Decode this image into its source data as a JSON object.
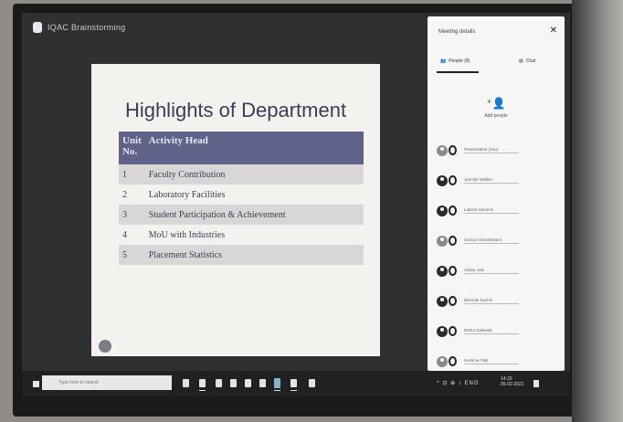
{
  "app": {
    "title": "IQAC Brainstorming"
  },
  "slide": {
    "title": "Highlights of Department",
    "columns": [
      "Unit No.",
      "Activity Head"
    ],
    "rows": [
      {
        "no": "1",
        "head": "Faculty Contribution"
      },
      {
        "no": "2",
        "head": "Laboratory Facilities"
      },
      {
        "no": "3",
        "head": "Student Participation & Achievement"
      },
      {
        "no": "4",
        "head": "MoU with Industries"
      },
      {
        "no": "5",
        "head": "Placement Statistics"
      }
    ]
  },
  "panel": {
    "header": "Meeting details",
    "tabs": [
      "People (8)",
      "Chat"
    ],
    "add_people_label": "Add people",
    "participants": [
      {
        "name": "Presentation (You)",
        "avatar": "photo"
      },
      {
        "name": "Jennifer Walker",
        "avatar": "letter"
      },
      {
        "name": "Latisha Stevens",
        "avatar": "letter"
      },
      {
        "name": "Gosavi Chandrakant",
        "avatar": "photo"
      },
      {
        "name": "Abhay Jain",
        "avatar": "letter"
      },
      {
        "name": "Bhosale Sachin",
        "avatar": "letter"
      },
      {
        "name": "Rahul Gaikwad",
        "avatar": "letter"
      },
      {
        "name": "Sushma Patil",
        "avatar": "photo"
      }
    ]
  },
  "taskbar": {
    "search_placeholder": "Type here to search",
    "tray_text": "^ ⊡ ⊕ ♪ ENG",
    "clock_time": "14:33",
    "clock_date": "05-02-2021"
  },
  "colors": {
    "table_header": "#5f6289",
    "panel_bg": "#f6f6f7",
    "screen_bg": "#2f3032"
  }
}
